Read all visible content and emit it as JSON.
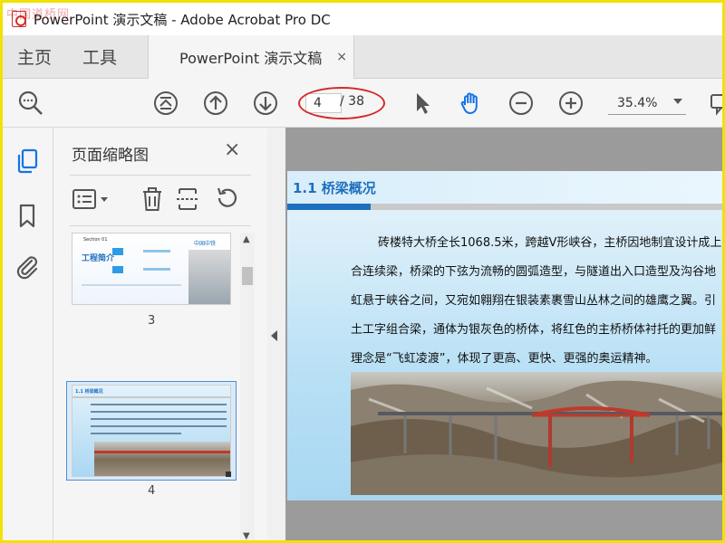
{
  "window": {
    "title": "PowerPoint 演示文稿 - Adobe Acrobat Pro DC",
    "watermark": "中国道桥网"
  },
  "tabs": {
    "home": "主页",
    "tools": "工具",
    "document": "PowerPoint 演示文稿",
    "close_glyph": "×"
  },
  "toolbar": {
    "current_page": "4",
    "total_pages": "/ 38",
    "zoom": "35.4%"
  },
  "thumbnails": {
    "title": "页面缩略图",
    "close_glyph": "×",
    "items": [
      {
        "label": "3",
        "heading": "工程简介",
        "section": "Section 01",
        "brand": "中国中铁"
      },
      {
        "label": "4",
        "heading": "1.1 桥梁概况",
        "selected": true
      }
    ]
  },
  "slide": {
    "title": "1.1 桥梁概况",
    "lines": [
      "砖楼特大桥全长1068.5米，跨越V形峡谷，主桥因地制宜设计成上",
      "合连续梁，桥梁的下弦为流畅的圆弧造型，与隧道出入口造型及沟谷地",
      "虹悬于峡谷之间，又宛如翱翔在银装素裹雪山丛林之间的雄鹰之翼。引",
      "土工字组合梁，通体为银灰色的桥体，将红色的主桥桥体衬托的更加鲜",
      "理念是“飞虹凌渡”，体现了更高、更快、更强的奥运精神。"
    ]
  },
  "colors": {
    "accent_blue": "#1f6fbf",
    "highlight_red": "#d42a2a",
    "frame_yellow": "#f2e200"
  }
}
